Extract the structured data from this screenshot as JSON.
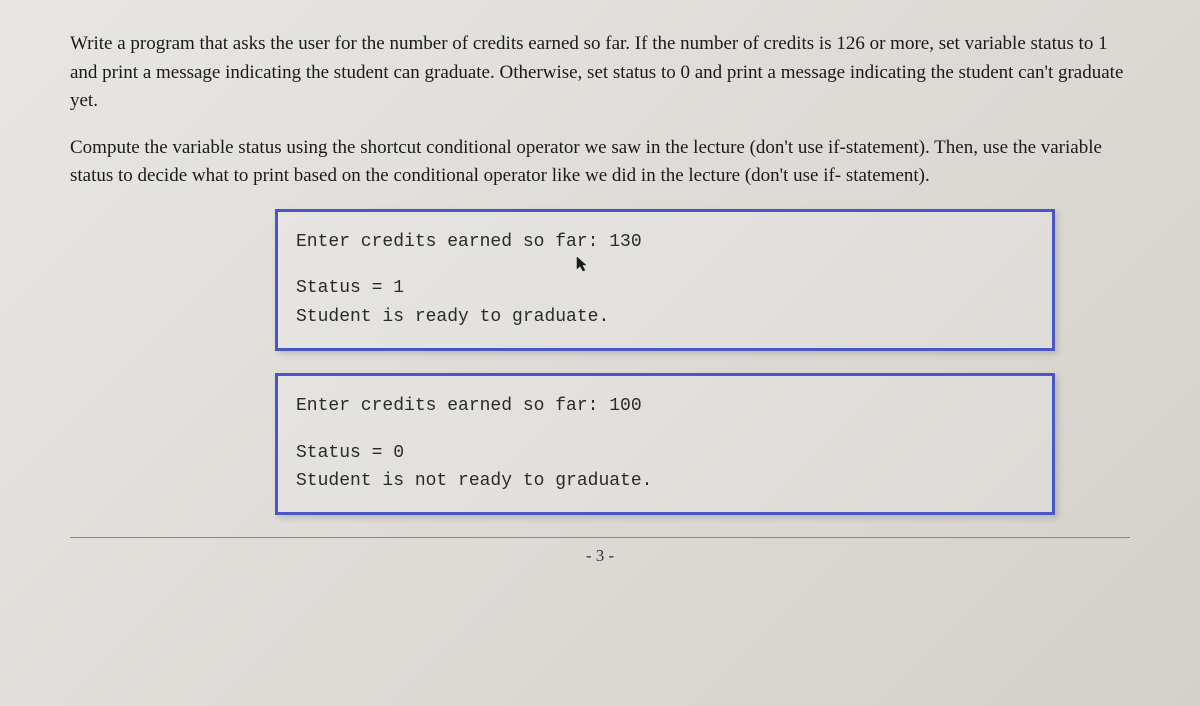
{
  "paragraph1": "Write a program that asks the user for the number of credits earned so far. If the number of credits is 126 or more, set variable status to 1 and print a message indicating the student can graduate. Otherwise, set status to 0 and print a message indicating the student can't graduate yet.",
  "paragraph2": "Compute the variable status using the shortcut conditional operator we saw in the lecture (don't use if-statement). Then, use the variable status to decide what to print based on the conditional operator like we did in the lecture (don't use if- statement).",
  "box1": {
    "line1": "Enter credits earned so far: 130",
    "line2": "Status = 1",
    "line3": "Student is ready to graduate."
  },
  "box2": {
    "line1": "Enter credits earned so far: 100",
    "line2": "Status = 0",
    "line3": "Student is not ready to graduate."
  },
  "pageNumber": "- 3 -",
  "cursorGlyph": "↖"
}
